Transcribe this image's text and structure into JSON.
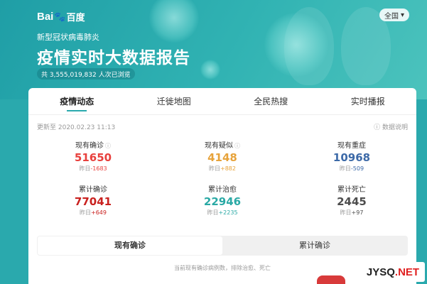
{
  "header": {
    "brand": {
      "latin": "Bai",
      "paw": "🐾",
      "cn": "百度"
    },
    "region_button": "全国",
    "subtitle": "新型冠状病毒肺炎",
    "title": "疫情实时大数据报告",
    "views": "共 3,555,019,832 人次已浏览"
  },
  "tabs": [
    "疫情动态",
    "迁徙地图",
    "全民热搜",
    "实时播报"
  ],
  "update_time": "更新至 2020.02.23 11:13",
  "data_explain": "数据说明",
  "stats": [
    {
      "label": "现有确诊",
      "value": "51650",
      "delta_prefix": "昨日",
      "delta": "-1683",
      "color": "#e8403d",
      "delta_color": "#e8403d",
      "info": true
    },
    {
      "label": "现有疑似",
      "value": "4148",
      "delta_prefix": "昨日",
      "delta": "+882",
      "color": "#e7a33b",
      "delta_color": "#e7a33b",
      "info": true
    },
    {
      "label": "现有重症",
      "value": "10968",
      "delta_prefix": "昨日",
      "delta": "-509",
      "color": "#3d6aa8",
      "delta_color": "#3d6aa8",
      "info": false
    },
    {
      "label": "累计确诊",
      "value": "77041",
      "delta_prefix": "昨日",
      "delta": "+649",
      "color": "#c9211f",
      "delta_color": "#c9211f",
      "info": false
    },
    {
      "label": "累计治愈",
      "value": "22946",
      "delta_prefix": "昨日",
      "delta": "+2235",
      "color": "#2aa9a5",
      "delta_color": "#2aa9a5",
      "info": false
    },
    {
      "label": "累计死亡",
      "value": "2445",
      "delta_prefix": "昨日",
      "delta": "+97",
      "color": "#4d4d4d",
      "delta_color": "#4d4d4d",
      "info": false
    }
  ],
  "segment": [
    "现有确诊",
    "累计确诊"
  ],
  "note": "当前现有确诊病例数，排除治愈、死亡",
  "watermark": {
    "left": "JYSQ",
    "right": ".NET"
  }
}
